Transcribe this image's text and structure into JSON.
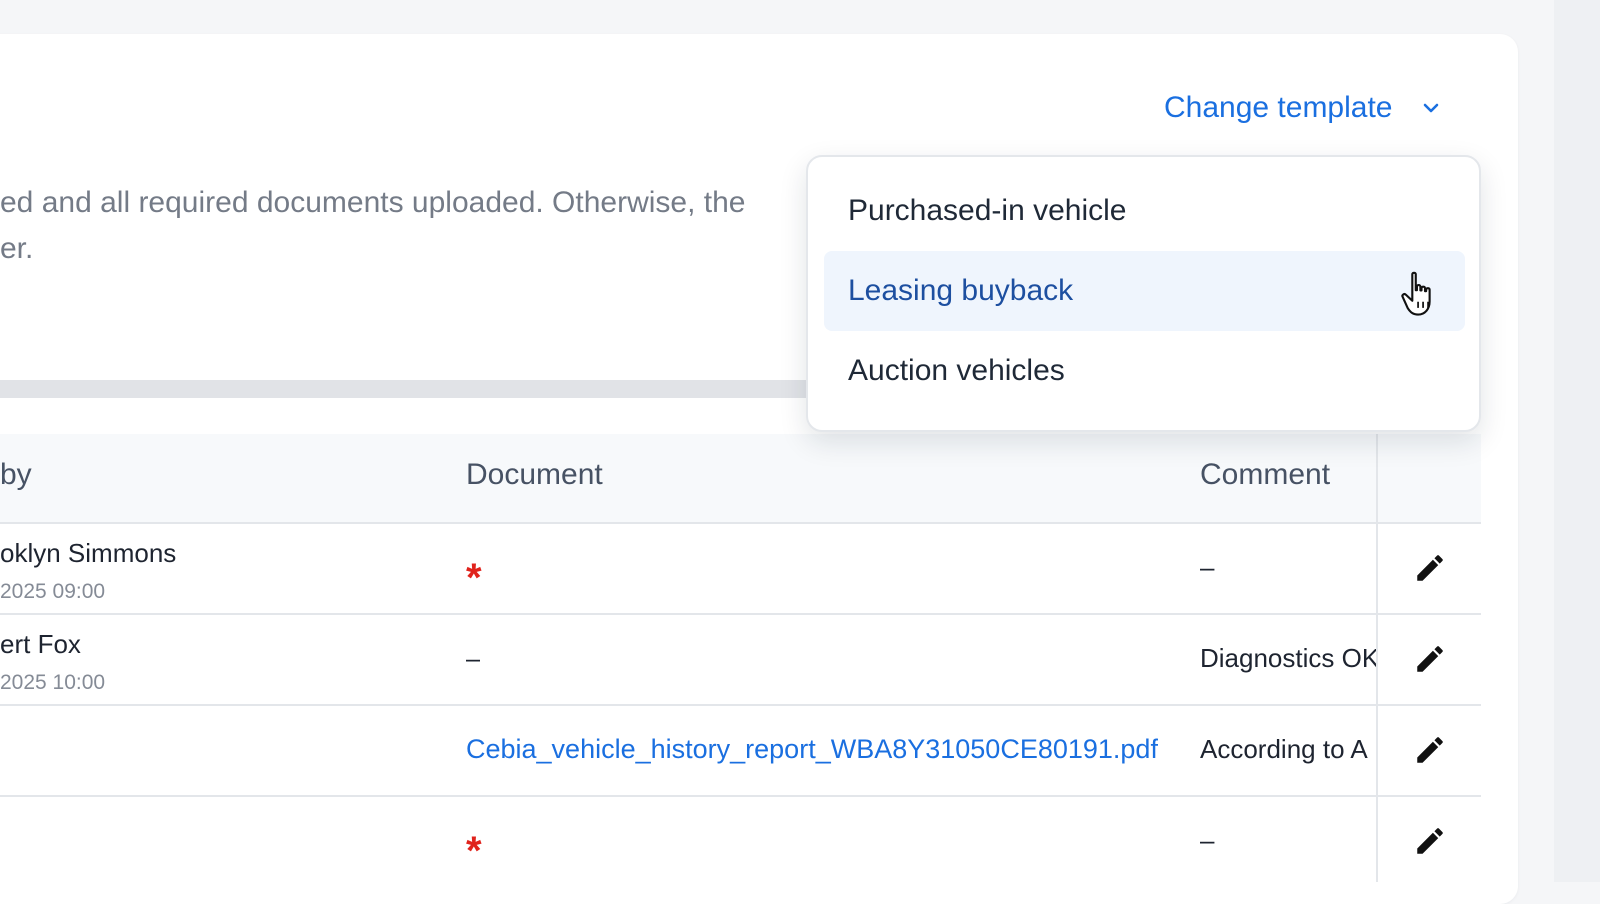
{
  "header": {
    "change_template_label": "Change template"
  },
  "notice": {
    "line1": "ed and all required documents uploaded. Otherwise, the",
    "line2": "er."
  },
  "table": {
    "columns": {
      "by": "by",
      "document": "Document",
      "comment": "Comment"
    },
    "rows": [
      {
        "by_name": "oklyn Simmons",
        "by_date": "2025 09:00",
        "document": "*",
        "document_type": "required",
        "comment": "–"
      },
      {
        "by_name": "ert Fox",
        "by_date": "2025 10:00",
        "document": "–",
        "document_type": "empty",
        "comment": "Diagnostics OK"
      },
      {
        "by_name": "",
        "by_date": "",
        "document": "Cebia_vehicle_history_report_WBA8Y31050CE80191.pdf",
        "document_type": "link",
        "comment": "According to A"
      },
      {
        "by_name": "",
        "by_date": "",
        "document": "*",
        "document_type": "required",
        "comment": "–"
      }
    ]
  },
  "template_dropdown": {
    "items": [
      {
        "label": "Purchased-in vehicle"
      },
      {
        "label": "Leasing buyback",
        "hovered": true
      },
      {
        "label": "Auction vehicles"
      }
    ]
  },
  "icons": {
    "dropdown_chevron": "chevron-down-icon",
    "row_action": "pencil-icon",
    "pointer": "hand-pointer-icon"
  },
  "colors": {
    "accent": "#1a6fe0",
    "required": "#e0231c",
    "hover_bg": "#eff5fd"
  }
}
